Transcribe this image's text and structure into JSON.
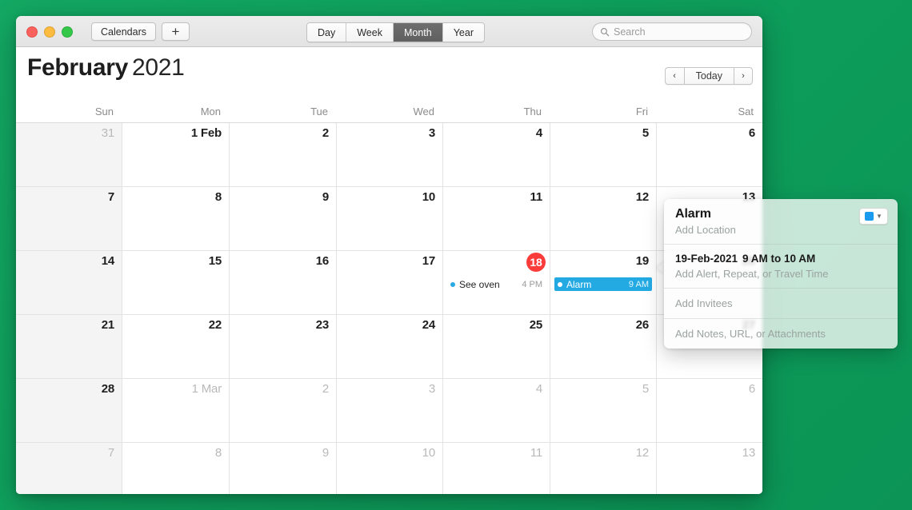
{
  "desktop": {
    "background_color": "#0ea05e"
  },
  "window": {
    "traffic_lights": [
      {
        "name": "close",
        "color": "#fc615d"
      },
      {
        "name": "minimize",
        "color": "#fdbc40"
      },
      {
        "name": "zoom",
        "color": "#34c749"
      }
    ],
    "toolbar": {
      "calendars_label": "Calendars",
      "add_label": "+",
      "views": [
        {
          "label": "Day",
          "active": false
        },
        {
          "label": "Week",
          "active": false
        },
        {
          "label": "Month",
          "active": true
        },
        {
          "label": "Year",
          "active": false
        }
      ],
      "search": {
        "placeholder": "Search",
        "value": "",
        "icon": "search-icon"
      }
    },
    "header": {
      "month": "February",
      "year": "2021",
      "prev_label": "‹",
      "today_label": "Today",
      "next_label": "›"
    }
  },
  "calendar": {
    "weekdays": [
      "Sun",
      "Mon",
      "Tue",
      "Wed",
      "Thu",
      "Fri",
      "Sat"
    ],
    "days": [
      {
        "label": "31",
        "dim": true,
        "today": false
      },
      {
        "label": "1 Feb",
        "dim": false,
        "today": false
      },
      {
        "label": "2",
        "dim": false,
        "today": false
      },
      {
        "label": "3",
        "dim": false,
        "today": false
      },
      {
        "label": "4",
        "dim": false,
        "today": false
      },
      {
        "label": "5",
        "dim": false,
        "today": false
      },
      {
        "label": "6",
        "dim": false,
        "today": false
      },
      {
        "label": "7",
        "dim": false,
        "today": false
      },
      {
        "label": "8",
        "dim": false,
        "today": false
      },
      {
        "label": "9",
        "dim": false,
        "today": false
      },
      {
        "label": "10",
        "dim": false,
        "today": false
      },
      {
        "label": "11",
        "dim": false,
        "today": false
      },
      {
        "label": "12",
        "dim": false,
        "today": false
      },
      {
        "label": "13",
        "dim": false,
        "today": false
      },
      {
        "label": "14",
        "dim": false,
        "today": false
      },
      {
        "label": "15",
        "dim": false,
        "today": false
      },
      {
        "label": "16",
        "dim": false,
        "today": false
      },
      {
        "label": "17",
        "dim": false,
        "today": false
      },
      {
        "label": "18",
        "dim": false,
        "today": true
      },
      {
        "label": "19",
        "dim": false,
        "today": false
      },
      {
        "label": "20",
        "dim": false,
        "today": false
      },
      {
        "label": "21",
        "dim": false,
        "today": false
      },
      {
        "label": "22",
        "dim": false,
        "today": false
      },
      {
        "label": "23",
        "dim": false,
        "today": false
      },
      {
        "label": "24",
        "dim": false,
        "today": false
      },
      {
        "label": "25",
        "dim": false,
        "today": false
      },
      {
        "label": "26",
        "dim": false,
        "today": false
      },
      {
        "label": "27",
        "dim": false,
        "today": false
      },
      {
        "label": "28",
        "dim": false,
        "today": false
      },
      {
        "label": "1 Mar",
        "dim": true,
        "today": false
      },
      {
        "label": "2",
        "dim": true,
        "today": false
      },
      {
        "label": "3",
        "dim": true,
        "today": false
      },
      {
        "label": "4",
        "dim": true,
        "today": false
      },
      {
        "label": "5",
        "dim": true,
        "today": false
      },
      {
        "label": "6",
        "dim": true,
        "today": false
      },
      {
        "label": "7",
        "dim": true,
        "today": false
      },
      {
        "label": "8",
        "dim": true,
        "today": false
      },
      {
        "label": "9",
        "dim": true,
        "today": false
      },
      {
        "label": "10",
        "dim": true,
        "today": false
      },
      {
        "label": "11",
        "dim": true,
        "today": false
      },
      {
        "label": "12",
        "dim": true,
        "today": false
      },
      {
        "label": "13",
        "dim": true,
        "today": false
      }
    ],
    "events": [
      {
        "cell_index": 18,
        "title": "See oven",
        "time": "4 PM",
        "selected": false,
        "dot_color": "#2aaae2"
      },
      {
        "cell_index": 19,
        "title": "Alarm",
        "time": "9 AM",
        "selected": true,
        "bar_color": "#23aae3"
      }
    ]
  },
  "popover": {
    "title": "Alarm",
    "location_placeholder": "Add Location",
    "calendar_color": "#1b9bf0",
    "chevron": "▼",
    "date": "19-Feb-2021",
    "time_range": "9 AM to 10 AM",
    "alert_placeholder": "Add Alert, Repeat, or Travel Time",
    "invitees_placeholder": "Add Invitees",
    "notes_placeholder": "Add Notes, URL, or Attachments"
  }
}
